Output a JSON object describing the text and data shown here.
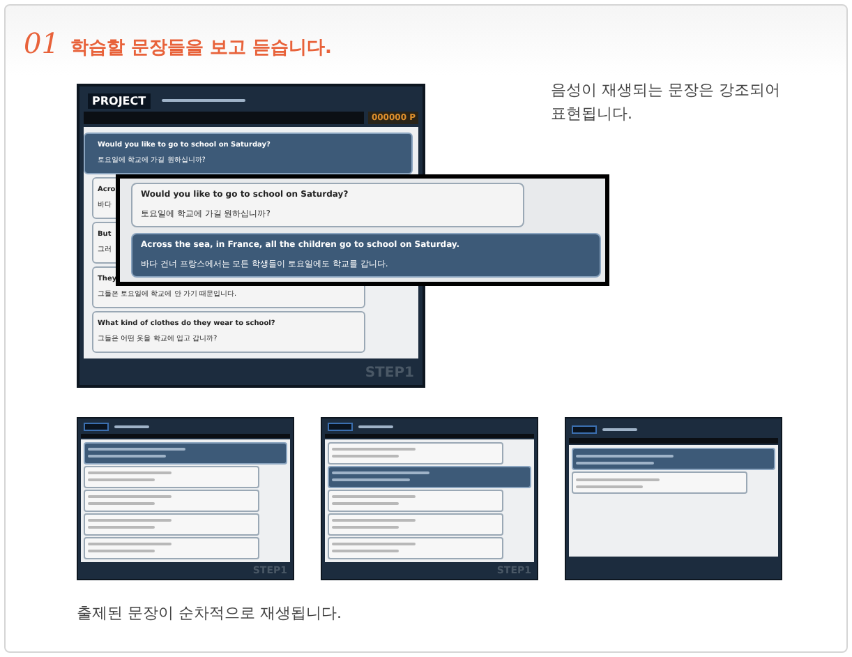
{
  "heading": {
    "number": "01",
    "title": "학습할 문장들을 보고 듣습니다."
  },
  "main_screen": {
    "logo": "PROJECT",
    "score": "000000 P",
    "step": "STEP1",
    "rows": [
      {
        "english": "Would you like to go to school on Saturday?",
        "korean": "토요일에 학교에 가길 원하십니까?",
        "selected": true
      },
      {
        "english": "Acro",
        "korean": "바다",
        "selected": false
      },
      {
        "english": "But",
        "korean": "그러",
        "selected": false
      },
      {
        "english": "They",
        "korean": "그들은 토요일에 학교에 안 가기 때문입니다.",
        "selected": false
      },
      {
        "english": "What kind of clothes do they wear to school?",
        "korean": "그들은 어떤 옷을 학교에 입고 갑니까?",
        "selected": false
      }
    ]
  },
  "zoom_popup": {
    "rows": [
      {
        "english": "Would you like to go to school on Saturday?",
        "korean": "토요일에 학교에 가길 원하십니까?",
        "selected": false
      },
      {
        "english": "Across the sea, in France, all the children go to school on Saturday.",
        "korean": "바다 건너 프랑스에서는 모든 학생들이 토요일에도 학교를 갑니다.",
        "selected": true
      }
    ]
  },
  "note": "음성이 재생되는 문장은 강조되어 표현됩니다.",
  "thumbnails": [
    {
      "step": "STEP1",
      "rows": [
        {
          "selected": true
        },
        {
          "selected": false
        },
        {
          "selected": false
        },
        {
          "selected": false
        },
        {
          "selected": false
        }
      ]
    },
    {
      "step": "STEP1",
      "rows": [
        {
          "selected": false
        },
        {
          "selected": true
        },
        {
          "selected": false
        },
        {
          "selected": false
        },
        {
          "selected": false
        }
      ]
    },
    {
      "rows": [
        {
          "selected": true
        },
        {
          "selected": false
        }
      ]
    }
  ],
  "caption": "출제된 문장이 순차적으로 재생됩니다."
}
